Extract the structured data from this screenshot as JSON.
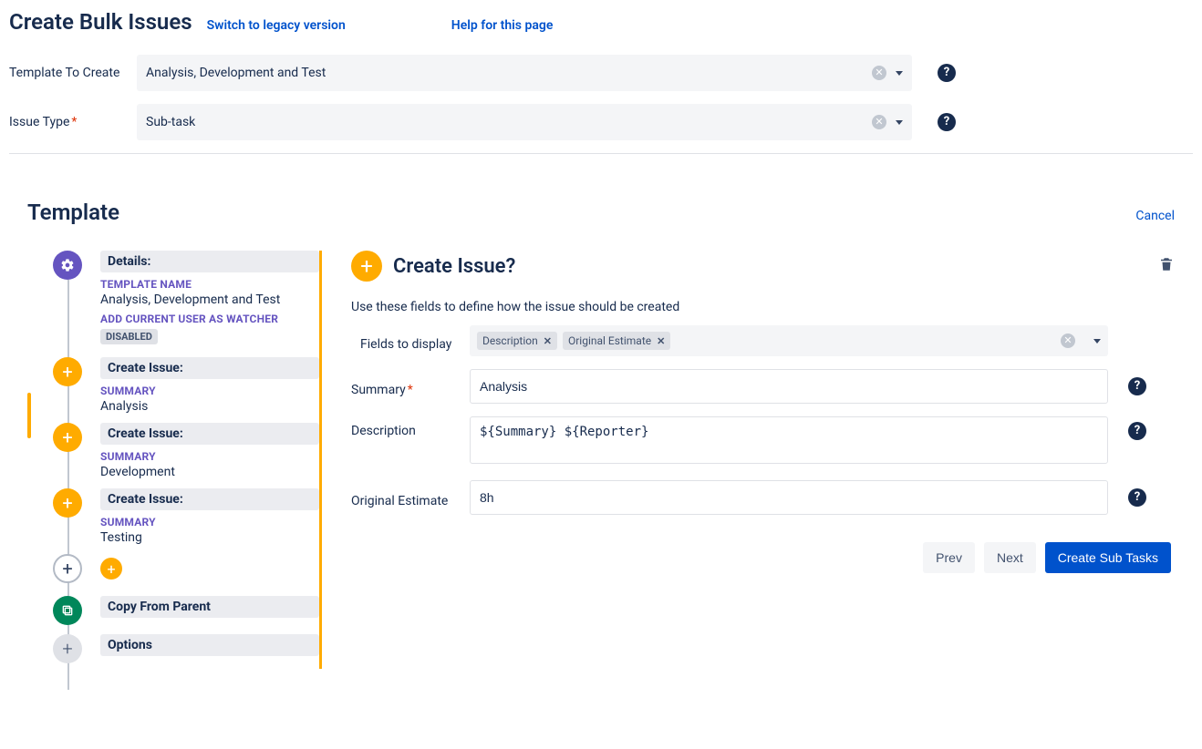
{
  "header": {
    "title": "Create Bulk Issues",
    "legacy_link": "Switch to legacy version",
    "help_link": "Help for this page"
  },
  "top_form": {
    "template_label": "Template To Create",
    "template_value": "Analysis, Development and Test",
    "issuetype_label": "Issue Type",
    "issuetype_value": "Sub-task"
  },
  "section": {
    "title": "Template",
    "cancel": "Cancel"
  },
  "tree": {
    "details_header": "Details:",
    "template_name_label": "TEMPLATE NAME",
    "template_name_value": "Analysis, Development and Test",
    "watcher_label": "ADD CURRENT USER AS WATCHER",
    "watcher_value": "DISABLED",
    "create_issue_header": "Create Issue:",
    "summary_label": "SUMMARY",
    "issue1_summary": "Analysis",
    "issue2_summary": "Development",
    "issue3_summary": "Testing",
    "copy_from_parent": "Copy From Parent",
    "options": "Options"
  },
  "main": {
    "title": "Create Issue?",
    "hint": "Use these fields to define how the issue should be created",
    "fields_to_display_label": "Fields to display",
    "chip1": "Description",
    "chip2": "Original Estimate",
    "summary_label": "Summary",
    "summary_value": "Analysis",
    "description_label": "Description",
    "description_value": "${Summary} ${Reporter}",
    "original_estimate_label": "Original Estimate",
    "original_estimate_value": "8h",
    "btn_prev": "Prev",
    "btn_next": "Next",
    "btn_submit": "Create Sub Tasks"
  }
}
